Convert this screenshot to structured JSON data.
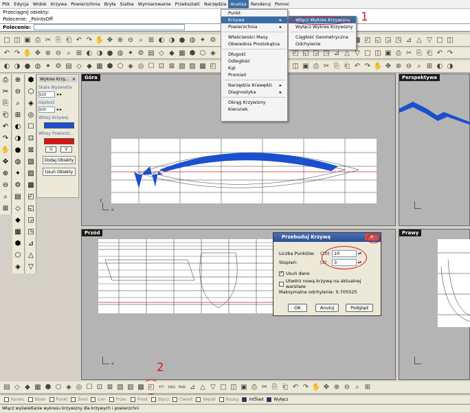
{
  "menubar": [
    "Plik",
    "Edycja",
    "Widok",
    "Krzywa",
    "Powierzchnia",
    "Bryła",
    "Siatka",
    "Wymiarowanie",
    "Przekształć",
    "Narzędzia",
    "Analiza",
    "Renderuj",
    "Pomoc"
  ],
  "command_history": [
    "Przeciągnij obiekty:",
    "Polecenie: _PointsOff"
  ],
  "command_prompt": "Polecenie:",
  "analysis_menu": {
    "items": [
      "Punkt",
      "Krzywa",
      "Powierzchnia",
      "Właściwości Masy",
      "Obwiednia Prostokątna",
      "Długość",
      "Odległość",
      "Kąt",
      "Promień",
      "Narzędzia Krawędzi",
      "Diagnostyka",
      "Okrąg Krzywizny",
      "Kierunek"
    ]
  },
  "curve_submenu": {
    "items": [
      "Włącz Wykres Krzywizny",
      "Wyłącz Wykres Krzywizny",
      "Ciągłość Geometryczna",
      "Odchylenie"
    ]
  },
  "panel": {
    "title": "Wykres Krzy...",
    "close": "✕",
    "scale_label": "Skala Wyświetla",
    "scale_value": "123",
    "density_label": "Gęstość",
    "density_value": "100",
    "curve_hair_label": "Włosy Krzywej",
    "surface_hair_label": "Włosy Powierzc...",
    "curve_color": "#1a4fd0",
    "surface_color": "#e01010",
    "u_label": "U",
    "v_label": "V",
    "add_button": "Dodaj Obiekty",
    "remove_button": "Usuń Obiekty"
  },
  "viewports": {
    "top": "Góra",
    "perspective": "Perspektywa",
    "front": "Przód",
    "right": "Prawy"
  },
  "axes": {
    "x": "x",
    "y": "y"
  },
  "dialog": {
    "title": "Przebuduj Krzywą",
    "close": "✕",
    "points_label": "Liczba Punktów:",
    "points_prev": "(20)",
    "points_value": "10",
    "degree_label": "Stopień:",
    "degree_prev": "(3)",
    "degree_value": "3",
    "delete_input": "Usuń dane",
    "new_layer": "Utwórz nową krzywą na aktualnej warstwie",
    "max_deviation": "Maksymalne odchylenie: 0.705525",
    "ok": "OK",
    "cancel": "Anuluj",
    "preview": "Podgląd"
  },
  "annotations": [
    "1",
    "2"
  ],
  "osnaps": [
    {
      "label": "Koniec",
      "on": false
    },
    {
      "label": "Bliski",
      "on": false
    },
    {
      "label": "Punkt",
      "on": false
    },
    {
      "label": "Środ",
      "on": false
    },
    {
      "label": "Cen",
      "on": false
    },
    {
      "label": "Przec",
      "on": false
    },
    {
      "label": "Prost",
      "on": false
    },
    {
      "label": "Stycz",
      "on": false
    },
    {
      "label": "Ćwiart",
      "on": false
    },
    {
      "label": "Węzeł",
      "on": false
    },
    {
      "label": "Rzutuj",
      "on": false
    },
    {
      "label": "IntŚlad",
      "on": true
    },
    {
      "label": "Wyłącz",
      "on": true
    }
  ],
  "status": "Włącz wyświetlanie wykresu krzywizny dla krzywych i powierzchni",
  "toolbar_labels": {
    "fit": "FIT",
    "deg": "DEG",
    "fair": "FAIR"
  }
}
